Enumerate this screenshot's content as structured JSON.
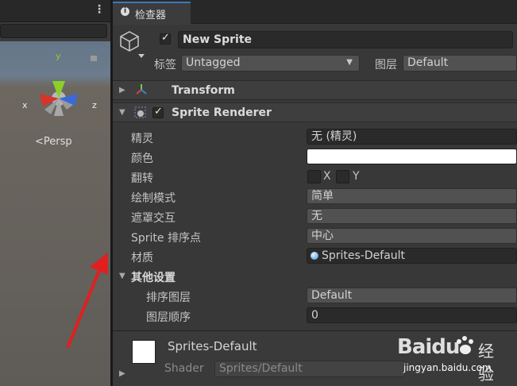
{
  "inspector_tab": {
    "label": "检查器"
  },
  "object": {
    "name": "New Sprite",
    "tag_label": "标签",
    "tag_value": "Untagged",
    "layer_label": "图层",
    "layer_value": "Default"
  },
  "components": {
    "transform": {
      "title": "Transform"
    },
    "sprite_renderer": {
      "title": "Sprite Renderer",
      "fields": {
        "sprite": {
          "label": "精灵",
          "value": "无 (精灵)"
        },
        "color": {
          "label": "颜色",
          "value": "#ffffff"
        },
        "flip": {
          "label": "翻转",
          "x_label": "X",
          "y_label": "Y"
        },
        "draw_mode": {
          "label": "绘制模式",
          "value": "简单"
        },
        "mask_interaction": {
          "label": "遮罩交互",
          "value": "无"
        },
        "sort_point": {
          "label": "Sprite 排序点",
          "value": "中心"
        },
        "material": {
          "label": "材质",
          "value": "Sprites-Default"
        }
      },
      "additional": {
        "title": "其他设置",
        "sorting_layer": {
          "label": "排序图层",
          "value": "Default"
        },
        "order_in_layer": {
          "label": "图层顺序",
          "value": "0"
        }
      }
    }
  },
  "material_preview": {
    "name": "Sprites-Default",
    "shader_label": "Shader",
    "shader_value": "Sprites/Default"
  },
  "scene": {
    "persp_label": "Persp",
    "axis_x": "x",
    "axis_y": "y",
    "axis_z": "z"
  },
  "watermark": {
    "brand": "Baidu",
    "brand_cn": "经验",
    "url": "jingyan.baidu.com"
  },
  "colors": {
    "accent": "#3a79bb",
    "arrow": "#e02020"
  }
}
